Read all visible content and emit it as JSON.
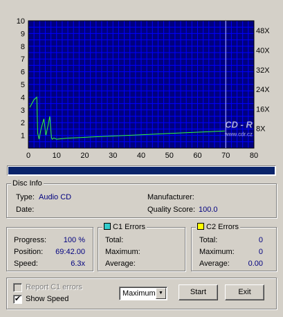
{
  "chart_data": {
    "type": "line",
    "x_ticks": [
      "0",
      "10",
      "20",
      "30",
      "40",
      "50",
      "60",
      "70",
      "80"
    ],
    "y_left_ticks": [
      "1",
      "2",
      "3",
      "4",
      "5",
      "6",
      "7",
      "8",
      "9",
      "10"
    ],
    "y_right_ticks": [
      "8X",
      "16X",
      "24X",
      "32X",
      "40X",
      "48X"
    ],
    "xlim": [
      0,
      80
    ],
    "ylim_left": [
      0,
      10
    ],
    "ylim_right": [
      0,
      52
    ],
    "grid": true,
    "background": "#000080",
    "grid_color": "#0000ff",
    "line_color": "#33ff33",
    "marker_color": "#c0c0ff",
    "marker_x": 70,
    "series": [
      {
        "axis": "left",
        "x": [
          0.5,
          1,
          2,
          3,
          3.3,
          3.8,
          4.5,
          5.5,
          6.2,
          7,
          7.6,
          8.2,
          8.5,
          9,
          10,
          12,
          14,
          16,
          18,
          20,
          25,
          30,
          35,
          40,
          45,
          50,
          55,
          60,
          65,
          69.7
        ],
        "y": [
          3.2,
          3.4,
          3.8,
          4.0,
          1.2,
          0.7,
          1.5,
          2.3,
          1.0,
          1.8,
          2.5,
          0.8,
          0.7,
          0.8,
          0.7,
          0.75,
          0.78,
          0.8,
          0.82,
          0.85,
          0.9,
          0.95,
          1.0,
          1.05,
          1.1,
          1.15,
          1.2,
          1.25,
          1.3,
          1.35
        ]
      }
    ]
  },
  "watermark": {
    "line1": "CD - R",
    "line2": "www.cdr.cz"
  },
  "progress_fraction": 1.0,
  "disc_info": {
    "legend": "Disc Info",
    "type_label": "Type:",
    "type_value": "Audio CD",
    "date_label": "Date:",
    "manufacturer_label": "Manufacturer:",
    "quality_label": "Quality Score:",
    "quality_value": "100.0"
  },
  "status": {
    "progress_label": "Progress:",
    "progress_value": "100 %",
    "position_label": "Position:",
    "position_value": "69:42.00",
    "speed_label": "Speed:",
    "speed_value": "6.3x"
  },
  "c1": {
    "legend": "C1 Errors",
    "color": "#33cccc",
    "total_label": "Total:",
    "maximum_label": "Maximum:",
    "average_label": "Average:"
  },
  "c2": {
    "legend": "C2 Errors",
    "color": "#ffff00",
    "total_label": "Total:",
    "total_value": "0",
    "maximum_label": "Maximum:",
    "maximum_value": "0",
    "average_label": "Average:",
    "average_value": "0.00"
  },
  "controls": {
    "report_c1_label": "Report C1 errors",
    "report_c1_checked": false,
    "show_speed_label": "Show Speed",
    "show_speed_checked": true,
    "mode_value": "Maximum",
    "start_label": "Start",
    "exit_label": "Exit"
  }
}
